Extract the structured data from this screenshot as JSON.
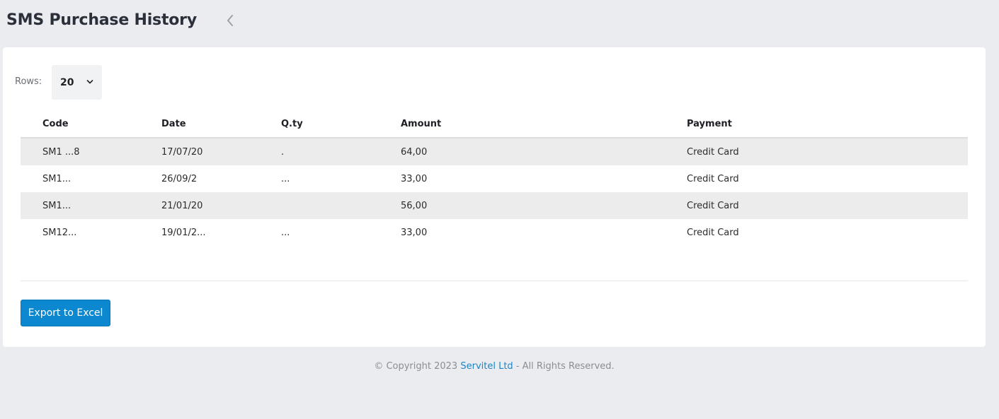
{
  "page": {
    "title": "SMS Purchase History",
    "back_icon": "chevron-left-icon"
  },
  "controls": {
    "rows_label": "Rows:",
    "rows_value": "20",
    "rows_icon": "chevron-down-icon"
  },
  "table": {
    "columns": [
      "Code",
      "Date",
      "Q.ty",
      "Amount",
      "Payment"
    ],
    "rows": [
      {
        "code": "SM1 ...8",
        "date": "17/07/20",
        "qty": ".",
        "amount": "64,00",
        "payment": "Credit Card"
      },
      {
        "code": "SM1...",
        "date": "26/09/2",
        "qty": "...",
        "amount": "33,00",
        "payment": "Credit Card"
      },
      {
        "code": "SM1...",
        "date": "21/01/20",
        "qty": "",
        "amount": "56,00",
        "payment": "Credit Card"
      },
      {
        "code": "SM12...",
        "date": "19/01/2...",
        "qty": "...",
        "amount": "33,00",
        "payment": "Credit Card"
      }
    ]
  },
  "actions": {
    "export_label": "Export to Excel"
  },
  "footer": {
    "prefix": "© Copyright 2023 ",
    "company": "Servitel Ltd",
    "suffix": " - All Rights Reserved."
  },
  "colors": {
    "accent": "#0b88cf",
    "background": "#ebecf0",
    "stripe": "#ececec"
  }
}
